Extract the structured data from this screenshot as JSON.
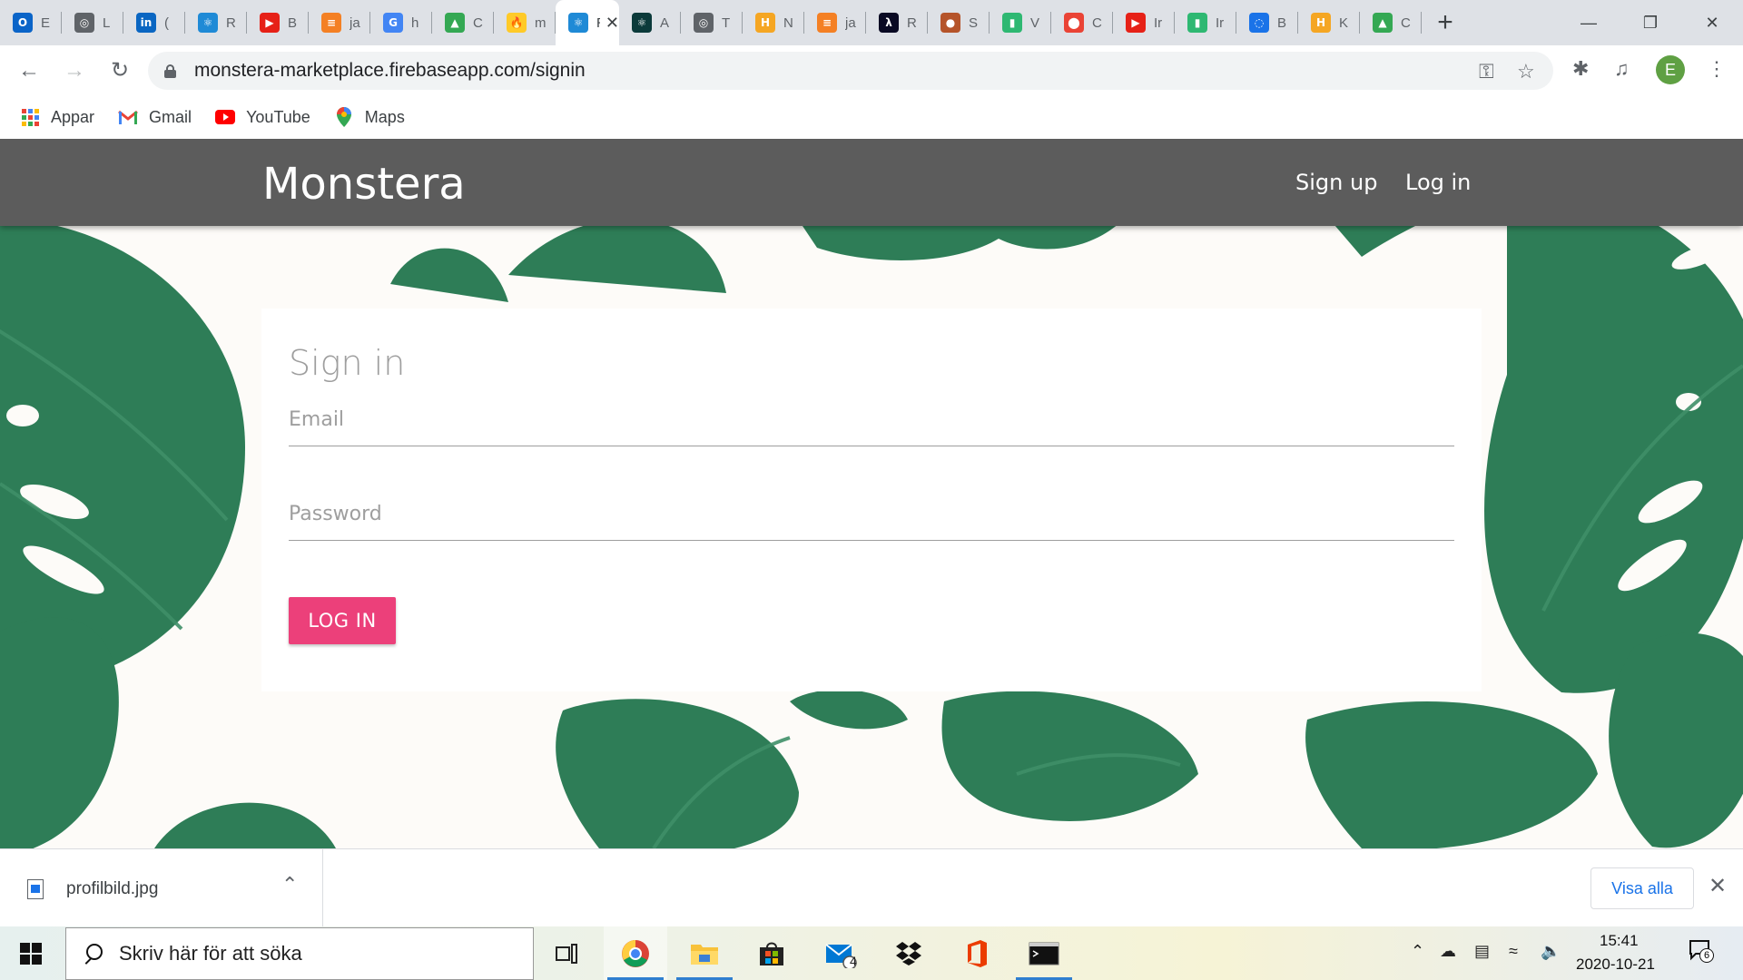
{
  "browser": {
    "tabs": [
      {
        "title": "E",
        "icon": "outlook-icon",
        "color": "#0a64c8"
      },
      {
        "title": "L",
        "icon": "globe-icon",
        "color": "#5f6368"
      },
      {
        "title": "(",
        "icon": "linkedin-icon",
        "color": "#0a66c2"
      },
      {
        "title": "R",
        "icon": "react-icon",
        "color": "#1f8ad6"
      },
      {
        "title": "B",
        "icon": "youtube-icon",
        "color": "#e62117"
      },
      {
        "title": "ja",
        "icon": "stackoverflow-icon",
        "color": "#f48024"
      },
      {
        "title": "h",
        "icon": "google-icon",
        "color": "#4285f4"
      },
      {
        "title": "C",
        "icon": "drive-icon",
        "color": "#34a853"
      },
      {
        "title": "m",
        "icon": "firebase-icon",
        "color": "#ffca28"
      },
      {
        "title": "Re",
        "icon": "react-icon",
        "color": "#1f8ad6",
        "active": true
      },
      {
        "title": "A",
        "icon": "react-icon",
        "color": "#0b3a3a"
      },
      {
        "title": "T",
        "icon": "globe-icon",
        "color": "#5f6368"
      },
      {
        "title": "N",
        "icon": "hackernoon-icon",
        "color": "#f5a623"
      },
      {
        "title": "ja",
        "icon": "stackoverflow-icon",
        "color": "#f48024"
      },
      {
        "title": "R",
        "icon": "freecodecamp-icon",
        "color": "#0a0a23"
      },
      {
        "title": "S",
        "icon": "planet-icon",
        "color": "#b5542a"
      },
      {
        "title": "V",
        "icon": "analytics-icon",
        "color": "#2eb872"
      },
      {
        "title": "C",
        "icon": "maps-icon",
        "color": "#ea4335"
      },
      {
        "title": "Ir",
        "icon": "youtube-icon",
        "color": "#e62117"
      },
      {
        "title": "Ir",
        "icon": "analytics-icon",
        "color": "#2eb872"
      },
      {
        "title": "B",
        "icon": "loading-icon",
        "color": "#1a73e8"
      },
      {
        "title": "K",
        "icon": "hackernoon-icon",
        "color": "#f5a623"
      },
      {
        "title": "C",
        "icon": "drive-icon",
        "color": "#34a853"
      }
    ],
    "new_tab_glyph": "+",
    "url": "monstera-marketplace.firebaseapp.com/signin",
    "profile_initial": "E",
    "bookmarks": [
      {
        "label": "Appar",
        "icon": "apps-icon"
      },
      {
        "label": "Gmail",
        "icon": "gmail-icon"
      },
      {
        "label": "YouTube",
        "icon": "youtube-icon"
      },
      {
        "label": "Maps",
        "icon": "maps-icon"
      }
    ]
  },
  "site": {
    "brand": "Monstera",
    "nav": {
      "signup": "Sign up",
      "login": "Log in"
    },
    "form": {
      "title": "Sign in",
      "email_placeholder": "Email",
      "password_placeholder": "Password",
      "submit": "LOG IN"
    },
    "colors": {
      "navbar": "#5c5c5c",
      "accent": "#ec407a",
      "leaf": "#2e7d57"
    }
  },
  "downloads": {
    "file": "profilbild.jpg",
    "show_all": "Visa alla"
  },
  "taskbar": {
    "search_placeholder": "Skriv här för att söka",
    "mail_badge": "4",
    "time": "15:41",
    "date": "2020-10-21",
    "notification_count": "6"
  }
}
